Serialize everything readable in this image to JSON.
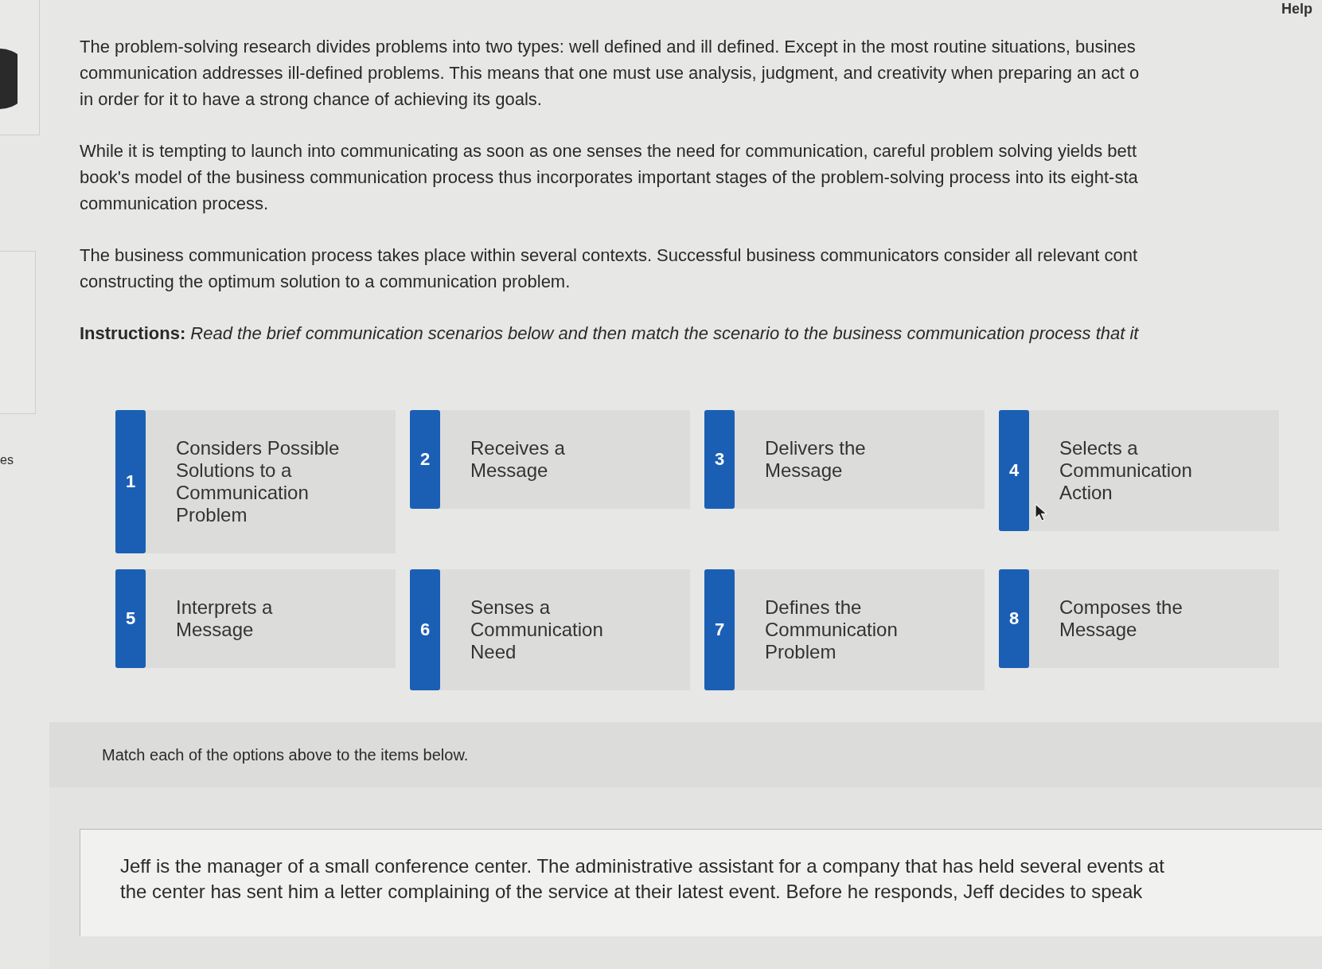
{
  "header": {
    "help_link": "Help"
  },
  "sidebar": {
    "label": "es"
  },
  "intro_paragraphs": [
    {
      "lines": [
        "The problem-solving research divides problems into two types: well defined and ill defined. Except in the most routine situations, busines",
        "communication addresses ill-defined problems. This means that one must use analysis, judgment, and creativity when preparing an act o",
        "in order for it to have a strong chance of achieving its goals."
      ]
    },
    {
      "lines": [
        "While it is tempting to launch into communicating as soon as one senses the need for communication, careful problem solving yields bett",
        "book's model of the business communication process thus incorporates important stages of the problem-solving process into its eight-sta",
        "communication process."
      ]
    },
    {
      "lines": [
        "The business communication process takes place within several contexts. Successful business communicators consider all relevant cont",
        "constructing the optimum solution to a communication problem."
      ]
    }
  ],
  "instructions": "**Instructions:** *Read the brief communication scenarios below and then match the scenario to the business communication process that it*",
  "options": [
    {
      "number": "1",
      "label": "Considers Possible Solutions to a Communication Problem"
    },
    {
      "number": "2",
      "label": "Receives a Message"
    },
    {
      "number": "3",
      "label": "Delivers the Message"
    },
    {
      "number": "4",
      "label": "Selects a Communication Action"
    },
    {
      "number": "5",
      "label": "Interprets a Message"
    },
    {
      "number": "6",
      "label": "Senses a Communication Need"
    },
    {
      "number": "7",
      "label": "Defines the Communication Problem"
    },
    {
      "number": "8",
      "label": "Composes the Message"
    }
  ],
  "match_prompt": "Match each of the options above to the items below.",
  "items": [
    {
      "text": "Jeff is the manager of a small conference center. The administrative assistant for a company that has held several events at the center has sent him a letter complaining of the service at their latest event. Before he responds, Jeff decides to speak"
    }
  ]
}
